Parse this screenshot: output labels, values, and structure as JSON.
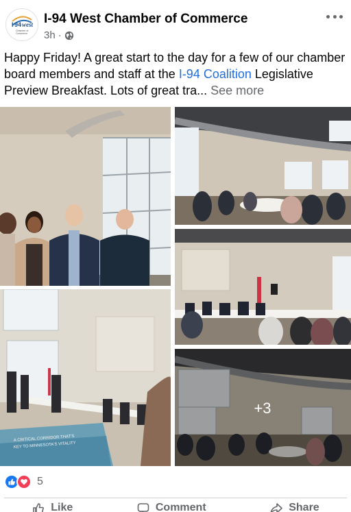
{
  "post": {
    "page_name": "I-94 West Chamber of Commerce",
    "time": "3h",
    "separator": "·",
    "privacy_icon": "globe-icon",
    "more_icon": "more-horizontal-icon"
  },
  "logo": {
    "number": "94",
    "word": "west",
    "line1": "Chamber of",
    "line2": "Commerce",
    "prefix": "I"
  },
  "caption": {
    "text_before_link": "Happy Friday! A great start to the day for a few of our chamber board members and staff at the ",
    "link": "I-94 Coalition",
    "text_after_link": " Legislative Preview Breakfast. Lots of great tra...",
    "see_more": "See more"
  },
  "photos": {
    "more_count": "+3",
    "booklet_line1": "A CRITICAL CORRIDOR THAT'S",
    "booklet_line2": "KEY TO MINNESOTA'S VITALITY"
  },
  "reactions": {
    "icons": [
      "like-icon",
      "love-icon"
    ],
    "count": "5"
  },
  "actions": {
    "like": "Like",
    "comment": "Comment",
    "share": "Share"
  },
  "colors": {
    "link": "#216fdb",
    "like": "#1877f2",
    "love": "#f33e58",
    "secondary_text": "#65676b"
  }
}
